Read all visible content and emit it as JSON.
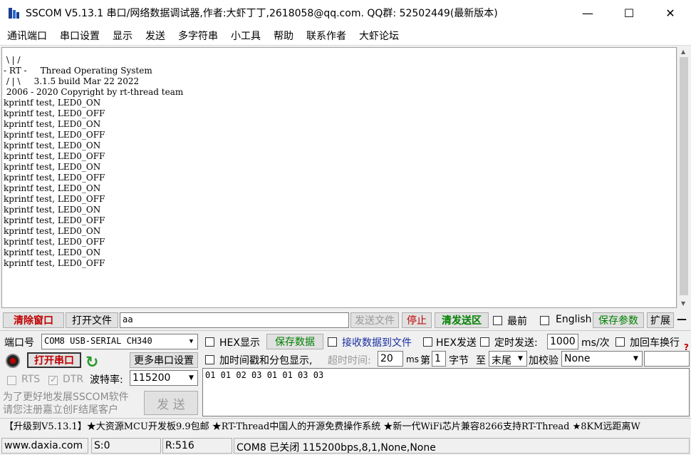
{
  "window": {
    "title": "SSCOM V5.13.1 串口/网络数据调试器,作者:大虾丁丁,2618058@qq.com. QQ群: 52502449(最新版本)",
    "minimize": "—",
    "maximize": "☐",
    "close": "✕"
  },
  "menu": [
    "通讯端口",
    "串口设置",
    "显示",
    "发送",
    "多字符串",
    "小工具",
    "帮助",
    "联系作者",
    "大虾论坛"
  ],
  "terminal": {
    "text": " \\ | /\n- RT -     Thread Operating System\n / | \\     3.1.5 build Mar 22 2022\n 2006 - 2020 Copyright by rt-thread team\nkprintf test, LED0_ON\nkprintf test, LED0_OFF\nkprintf test, LED0_ON\nkprintf test, LED0_OFF\nkprintf test, LED0_ON\nkprintf test, LED0_OFF\nkprintf test, LED0_ON\nkprintf test, LED0_OFF\nkprintf test, LED0_ON\nkprintf test, LED0_OFF\nkprintf test, LED0_ON\nkprintf test, LED0_OFF\nkprintf test, LED0_ON\nkprintf test, LED0_OFF\nkprintf test, LED0_ON\nkprintf test, LED0_OFF"
  },
  "toolbar1": {
    "clear_window": "清除窗口",
    "open_file": "打开文件",
    "file_path": "aa",
    "send_file": "发送文件",
    "stop": "停止",
    "clear_send": "清发送区",
    "topmost": "最前",
    "english": "English",
    "save_params": "保存参数",
    "expand": "扩展",
    "dash": "—"
  },
  "port": {
    "label": "端口号",
    "value": "COM8 USB-SERIAL CH340",
    "open_button": "打开串口",
    "more_settings": "更多串口设置",
    "rts": "RTS",
    "dtr": "DTR",
    "baud_label": "波特率:",
    "baud_value": "115200"
  },
  "options": {
    "hex_display": "HEX显示",
    "save_data": "保存数据",
    "recv_to_file": "接收数据到文件",
    "hex_send": "HEX发送",
    "timed_send": "定时发送:",
    "interval": "1000",
    "interval_unit": "ms/次",
    "add_newline": "加回车换行",
    "help_mark": "?",
    "timestamp": "加时间戳和分包显示,",
    "timeout_label": "超时时间:",
    "timeout_value": "20",
    "timeout_unit": "ms",
    "byte_prefix": "第",
    "byte_index": "1",
    "byte_unit": "字节",
    "to_label": "至",
    "to_value": "末尾",
    "checksum_label": "加校验",
    "checksum_value": "None"
  },
  "send": {
    "content": "01 01 02 03 01 01 03 03",
    "button": "发  送",
    "promo_line1": "为了更好地发展SSCOM软件",
    "promo_line2": "请您注册嘉立创F结尾客户"
  },
  "ad_banner": "【升级到V5.13.1】★大资源MCU开发板9.9包邮 ★RT-Thread中国人的开源免费操作系统 ★新一代WiFi芯片兼容8266支持RT-Thread ★8KM远距离W",
  "status": {
    "website": "www.daxia.com",
    "sent": "S:0",
    "received": "R:516",
    "port_state": "COM8 已关闭  115200bps,8,1,None,None"
  }
}
